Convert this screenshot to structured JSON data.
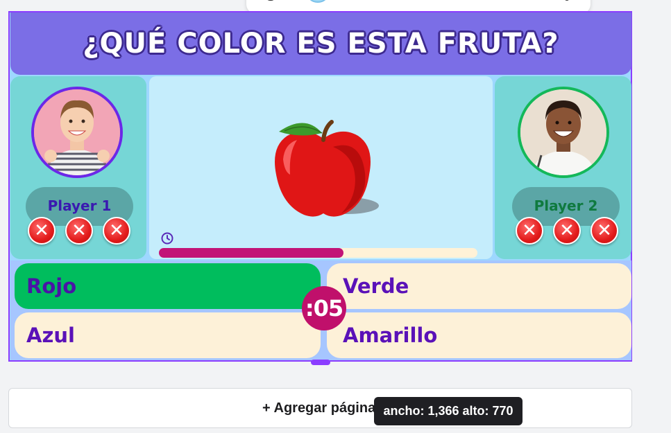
{
  "quiz": {
    "title": "¿QUÉ COLOR ES ESTA FRUTA?",
    "countdown": ":05",
    "timer_progress": 0.58,
    "players": [
      {
        "name": "Player 1",
        "avatar": "boy-avatar",
        "ring_color": "#6b28e8",
        "strikes": [
          "x-mark-icon",
          "x-mark-icon",
          "x-mark-icon"
        ]
      },
      {
        "name": "Player 2",
        "avatar": "boy-avatar",
        "ring_color": "#14b85a",
        "strikes": [
          "x-mark-icon",
          "x-mark-icon",
          "x-mark-icon"
        ]
      }
    ],
    "answers": [
      {
        "label": "Rojo",
        "correct": true
      },
      {
        "label": "Verde",
        "correct": false
      },
      {
        "label": "Azul",
        "correct": false
      },
      {
        "label": "Amarillo",
        "correct": false
      }
    ],
    "image": "apple-image",
    "strike_glyph": "✕"
  },
  "editor": {
    "add_page_label": "+ Agregar página",
    "size_tooltip": "ancho: 1,366 alto: 770",
    "accent_color": "#8b3dff"
  },
  "colors": {
    "title_bar": "#7b6ee6",
    "panel": "#76d6d6",
    "correct": "#00bd5d",
    "answer": "#fdf1d8",
    "timer": "#c21477"
  }
}
